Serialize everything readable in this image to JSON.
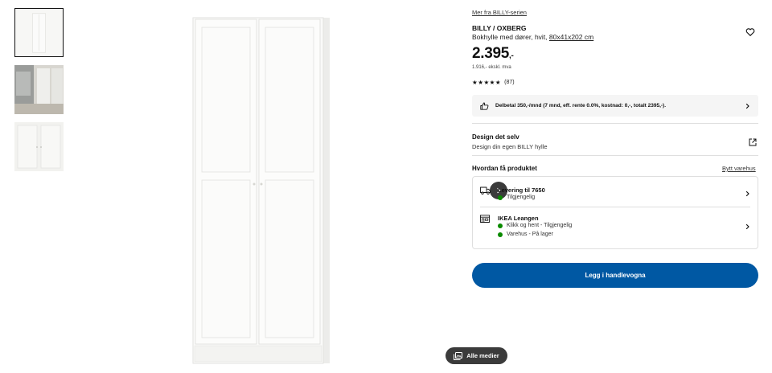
{
  "product": {
    "series_link": "Mer fra BILLY-serien",
    "name": "BILLY / OXBERG",
    "description": "Bokhylle med dører, hvit, ",
    "dimensions": "80x41x202 cm",
    "price_main": "2.395",
    "price_suffix": ",-",
    "price_ex_vat": "1.916,- ekskl. mva",
    "rating_stars": "★★★★★",
    "rating_count": "(87)"
  },
  "finance": {
    "text": "Delbetal 350,-/mnd (7 mnd, eff. rente 0.0%, kostnad: 0,-, totalt 2395,-)."
  },
  "design": {
    "title": "Design det selv",
    "subtitle": "Design din egen BILLY hylle"
  },
  "fulfilment": {
    "heading": "Hvordan få produktet",
    "change_store": "Bytt varehus",
    "delivery": {
      "title": "Levering til 7650",
      "status": "Tilgjengelig"
    },
    "store": {
      "title": "IKEA Leangen",
      "click_collect": "Klikk og hent - Tilgjengelig",
      "in_store": "Varehus - På lager"
    }
  },
  "cart": {
    "button_label": "Legg i handlevogna"
  },
  "media": {
    "all_media_label": "Alle medier"
  },
  "colors": {
    "primary": "#0058a3",
    "available": "#0a8a00",
    "dark_button": "#3b3b3b"
  },
  "icons": [
    "heart-icon",
    "thumbs-up-icon",
    "chevron-right-icon",
    "external-link-icon",
    "truck-icon",
    "store-icon",
    "media-gallery-icon"
  ]
}
